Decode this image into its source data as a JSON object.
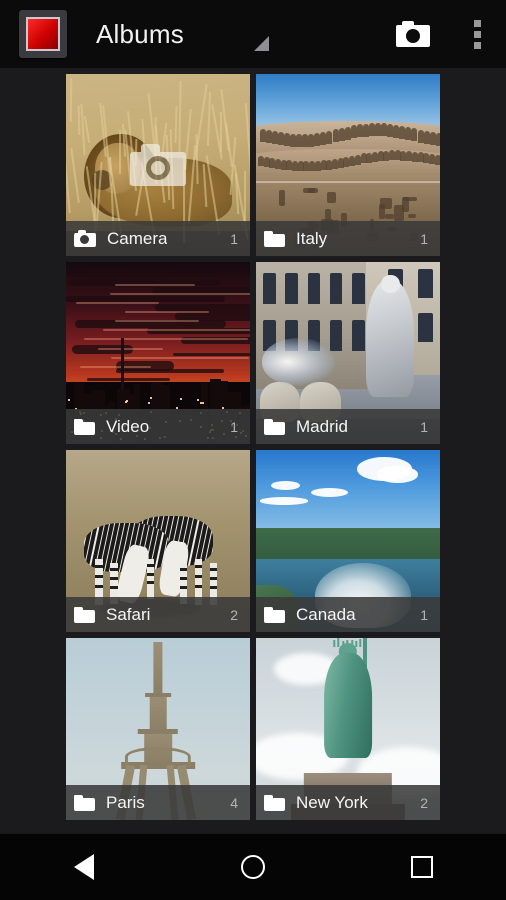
{
  "app": {
    "title": "Albums",
    "icon_name": "gallery-app-icon",
    "icon_color": "#cc0000"
  },
  "actionbar": {
    "spinner_icon": "dropdown-triangle-icon",
    "camera_action": "camera-icon",
    "overflow_action": "overflow-menu-icon",
    "background": "#0b0b0b"
  },
  "albums": [
    {
      "name": "Camera",
      "count": "1",
      "icon": "camera-icon",
      "scene": "savanna",
      "alt": "Lion resting in dry savanna grass",
      "has_camera_overlay": true
    },
    {
      "name": "Italy",
      "count": "1",
      "icon": "folder-icon",
      "scene": "colosseum",
      "alt": "Interior of the Roman Colosseum under blue sky",
      "has_camera_overlay": false
    },
    {
      "name": "Video",
      "count": "1",
      "icon": "folder-icon",
      "scene": "sunsetcity",
      "alt": "Red and orange sunset over a city skyline",
      "has_camera_overlay": false
    },
    {
      "name": "Madrid",
      "count": "1",
      "icon": "folder-icon",
      "scene": "madrid",
      "alt": "Cibeles fountain statues with water spray",
      "has_camera_overlay": false
    },
    {
      "name": "Safari",
      "count": "2",
      "icon": "folder-icon",
      "scene": "zebras",
      "alt": "Two zebras grazing on sandy ground",
      "has_camera_overlay": false
    },
    {
      "name": "Canada",
      "count": "1",
      "icon": "folder-icon",
      "scene": "niagara",
      "alt": "Niagara Falls with mist under a blue cloudy sky",
      "has_camera_overlay": false
    },
    {
      "name": "Paris",
      "count": "4",
      "icon": "folder-icon",
      "scene": "eiffel",
      "alt": "Eiffel Tower against pale blue sky",
      "has_camera_overlay": false
    },
    {
      "name": "New York",
      "count": "2",
      "icon": "folder-icon",
      "scene": "liberty",
      "alt": "Statue of Liberty against overcast sky",
      "has_camera_overlay": false
    }
  ],
  "navbar": {
    "back": "back-triangle-icon",
    "home": "home-circle-icon",
    "recents": "recents-square-icon"
  },
  "colors": {
    "page_background": "#1b1b1d",
    "label_bar": "rgba(58,58,58,0.88)",
    "label_text": "#f5f5f5",
    "count_text": "#b4b4b4"
  }
}
